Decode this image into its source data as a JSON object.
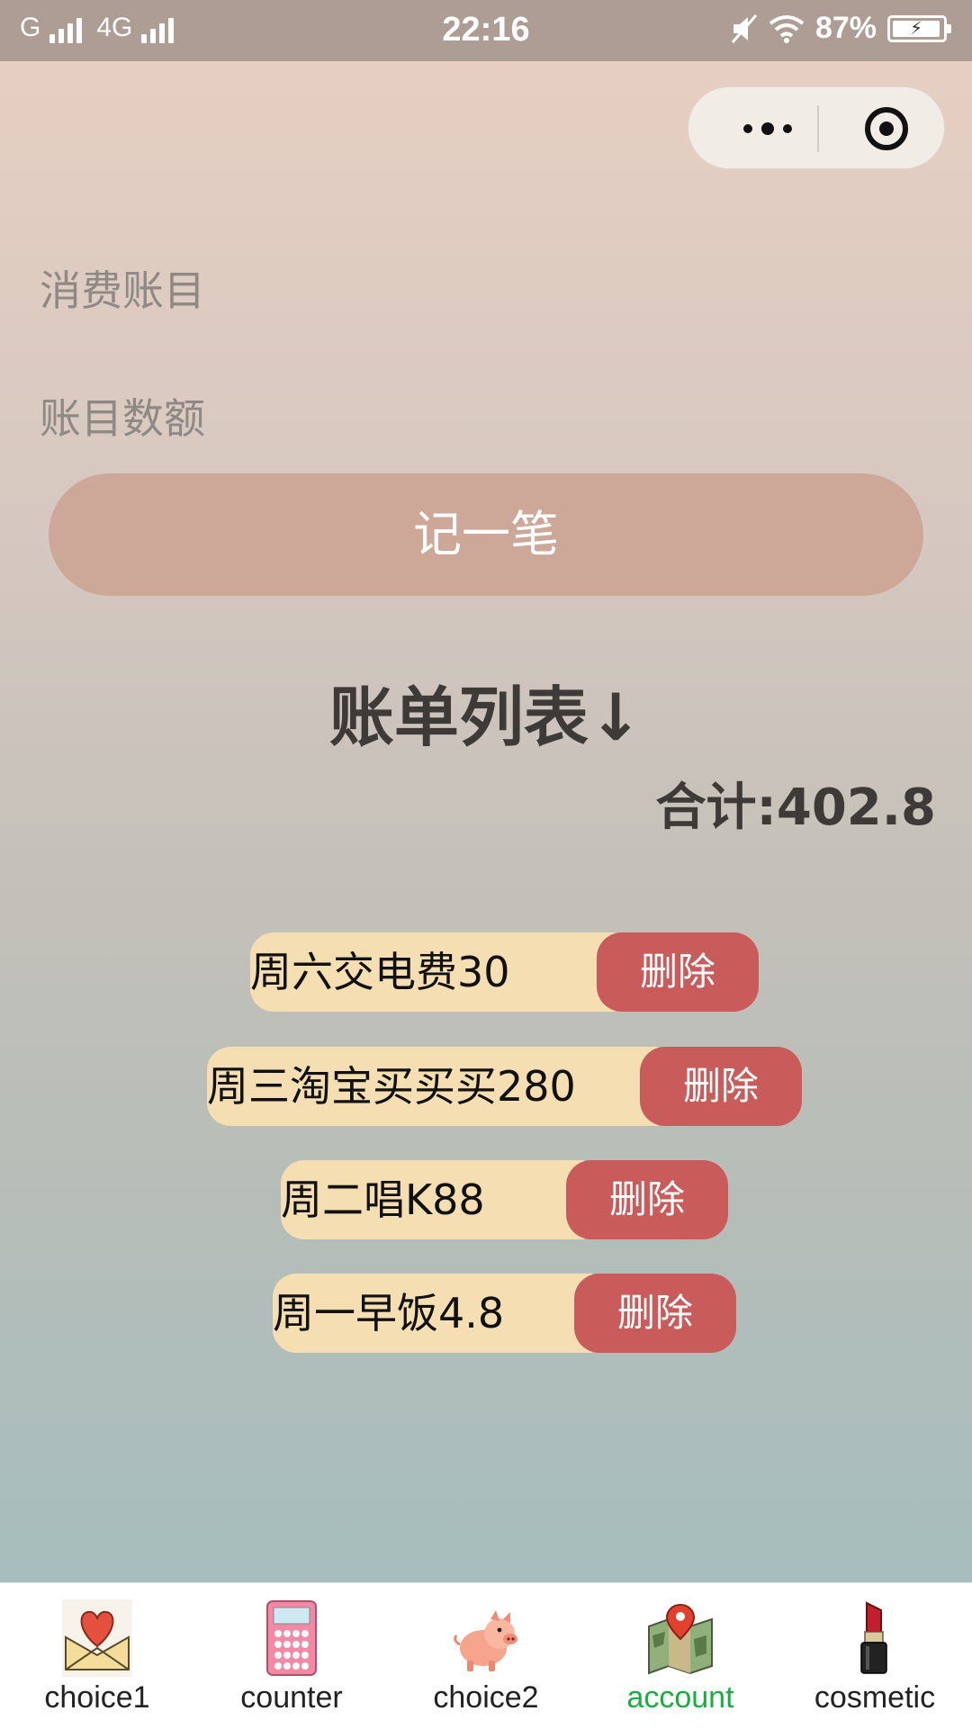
{
  "status_bar": {
    "carrier1": "G",
    "carrier2": "4G",
    "time": "22:16",
    "battery": "87%"
  },
  "form": {
    "item_placeholder": "消费账目",
    "amount_placeholder": "账目数额",
    "submit_label": "记一笔"
  },
  "list": {
    "title": "账单列表↓",
    "total_label": "合计:402.8",
    "items": [
      {
        "text": "周六交电费30",
        "delete_label": "删除"
      },
      {
        "text": "周三淘宝买买买280",
        "delete_label": "删除"
      },
      {
        "text": "周二唱K88",
        "delete_label": "删除"
      },
      {
        "text": "周一早饭4.8",
        "delete_label": "删除"
      }
    ]
  },
  "tabbar": {
    "active_color": "#1aad3f",
    "tabs": [
      {
        "label": "choice1",
        "icon": "love-letter-icon"
      },
      {
        "label": "counter",
        "icon": "calculator-icon"
      },
      {
        "label": "choice2",
        "icon": "pig-icon"
      },
      {
        "label": "account",
        "icon": "map-icon",
        "active": true
      },
      {
        "label": "cosmetic",
        "icon": "lipstick-icon"
      }
    ]
  },
  "colors": {
    "submit_button": "#cda898",
    "item_background": "#f5deb2",
    "delete_button": "#c95c5a"
  }
}
